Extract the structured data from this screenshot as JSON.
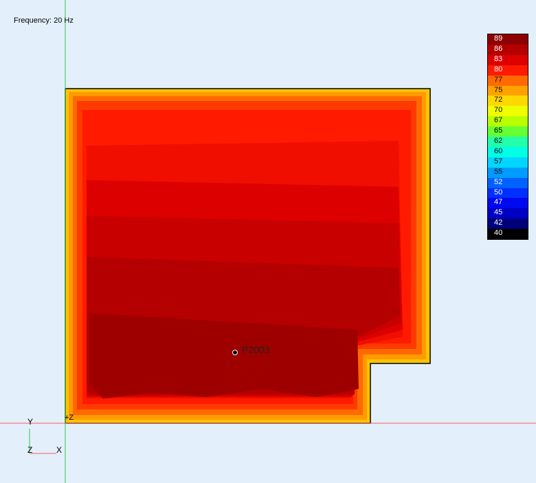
{
  "header": {
    "frequency_label": "Frequency: 20 Hz"
  },
  "legend": {
    "entries": [
      {
        "label": "89",
        "color": "#8f0000"
      },
      {
        "label": "86",
        "color": "#b40000"
      },
      {
        "label": "83",
        "color": "#dc0000"
      },
      {
        "label": "80",
        "color": "#ff1a00"
      },
      {
        "label": "77",
        "color": "#ff6a00"
      },
      {
        "label": "75",
        "color": "#ffa200"
      },
      {
        "label": "72",
        "color": "#ffd800"
      },
      {
        "label": "70",
        "color": "#f0ff00"
      },
      {
        "label": "67",
        "color": "#b8ff00"
      },
      {
        "label": "65",
        "color": "#66ff33"
      },
      {
        "label": "62",
        "color": "#22ffaa"
      },
      {
        "label": "60",
        "color": "#00ffe6"
      },
      {
        "label": "57",
        "color": "#00d6ff"
      },
      {
        "label": "55",
        "color": "#009cff"
      },
      {
        "label": "52",
        "color": "#0062ff"
      },
      {
        "label": "50",
        "color": "#0030ff"
      },
      {
        "label": "47",
        "color": "#0008f0"
      },
      {
        "label": "45",
        "color": "#0000c4"
      },
      {
        "label": "42",
        "color": "#00007a"
      },
      {
        "label": "40",
        "color": "#000000"
      }
    ]
  },
  "probe": {
    "label": "P2003"
  },
  "axes": {
    "y": "Y",
    "z": "Z",
    "x": "X",
    "plus_z": "+Z"
  },
  "colors": {
    "background": "#e3effb",
    "axis_line_h": "#ff5a5a",
    "axis_line_v": "#2ecc40",
    "edge": "#ffe400",
    "core": "#9e0000"
  }
}
